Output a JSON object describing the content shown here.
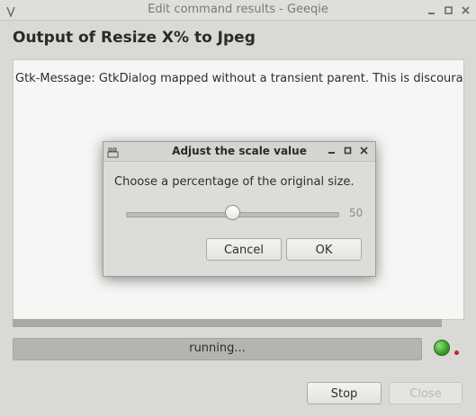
{
  "window": {
    "title": "Edit command results - Geeqie"
  },
  "heading": "Output of Resize X% to Jpeg",
  "output": {
    "text": "Gtk-Message: GtkDialog mapped without a transient parent. This is discourag"
  },
  "progress": {
    "label": "running...",
    "fraction": 1.0
  },
  "buttons": {
    "stop": "Stop",
    "close": "Close"
  },
  "dialog": {
    "title": "Adjust the scale value",
    "prompt": "Choose a percentage of the original size.",
    "slider": {
      "value": 50,
      "min": 0,
      "max": 100,
      "value_label": "50"
    },
    "cancel": "Cancel",
    "ok": "OK"
  },
  "colors": {
    "status_ok": "#3ea32f",
    "status_alert": "#c9202a"
  }
}
